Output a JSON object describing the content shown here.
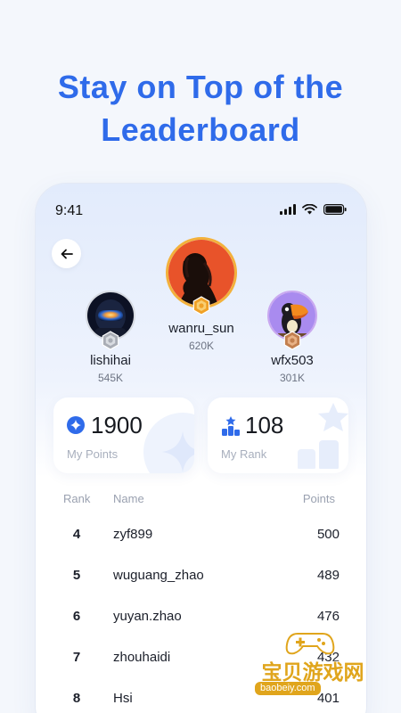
{
  "headline": {
    "line1": "Stay on Top of the",
    "line2": "Leaderboard"
  },
  "status_bar": {
    "time": "9:41"
  },
  "podium": [
    {
      "place": 2,
      "name": "lishihai",
      "points": "545K",
      "medal": "silver"
    },
    {
      "place": 1,
      "name": "wanru_sun",
      "points": "620K",
      "medal": "gold"
    },
    {
      "place": 3,
      "name": "wfx503",
      "points": "301K",
      "medal": "bronze"
    }
  ],
  "stats": {
    "points": {
      "value": "1900",
      "label": "My Points"
    },
    "rank": {
      "value": "108",
      "label": "My Rank"
    }
  },
  "table": {
    "headers": {
      "rank": "Rank",
      "name": "Name",
      "points": "Points"
    },
    "rows": [
      {
        "rank": "4",
        "name": "zyf899",
        "points": "500"
      },
      {
        "rank": "5",
        "name": "wuguang_zhao",
        "points": "489"
      },
      {
        "rank": "6",
        "name": "yuyan.zhao",
        "points": "476"
      },
      {
        "rank": "7",
        "name": "zhouhaidi",
        "points": "432"
      },
      {
        "rank": "8",
        "name": "Hsi",
        "points": "401"
      }
    ]
  },
  "watermark": {
    "text": "宝贝游戏网",
    "url": "baobeiy.com"
  },
  "colors": {
    "accent": "#2f6bea",
    "gold": "#f2a22a",
    "silver": "#b9bcc2",
    "bronze": "#c9875a"
  }
}
